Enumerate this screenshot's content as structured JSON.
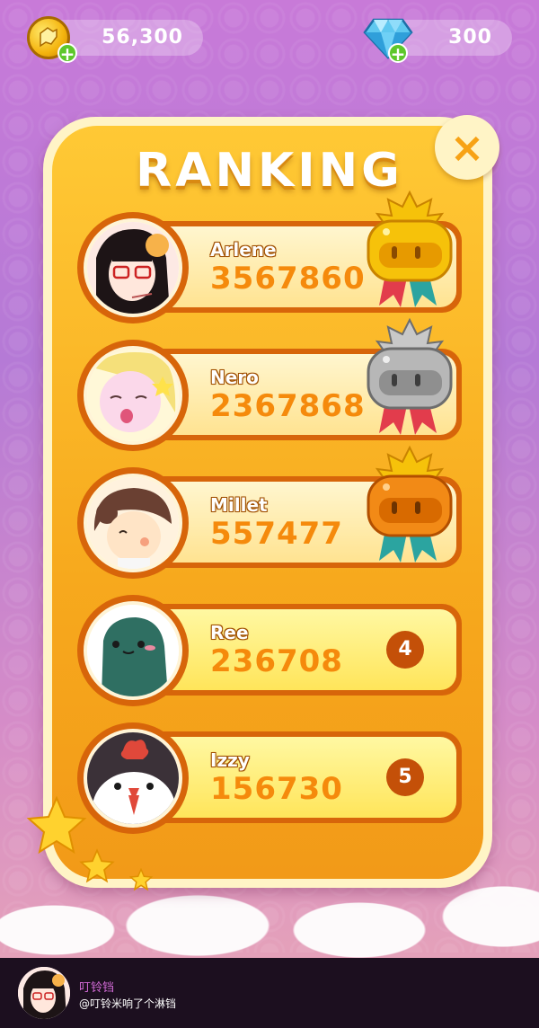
{
  "currency": {
    "coins": "56,300",
    "gems": "300"
  },
  "title": "RANKING",
  "close_label": "×",
  "players": [
    {
      "name": "Arlene",
      "score": "3567860",
      "rank": "1",
      "medal": "gold"
    },
    {
      "name": "Nero",
      "score": "2367868",
      "rank": "2",
      "medal": "silver"
    },
    {
      "name": "Millet",
      "score": "557477",
      "rank": "3",
      "medal": "bronze"
    },
    {
      "name": "Ree",
      "score": "236708",
      "rank": "4"
    },
    {
      "name": "Izzy",
      "score": "156730",
      "rank": "5"
    }
  ],
  "colors": {
    "gold_medal": "#f6c20a",
    "silver_medal": "#b7b7b7",
    "bronze_medal": "#f28a16",
    "rank_badge": "#c45008",
    "score_text": "#f58a0c"
  },
  "footer": {
    "author": "叮铃铛",
    "handle": "@叮铃米响了个淋铛"
  }
}
